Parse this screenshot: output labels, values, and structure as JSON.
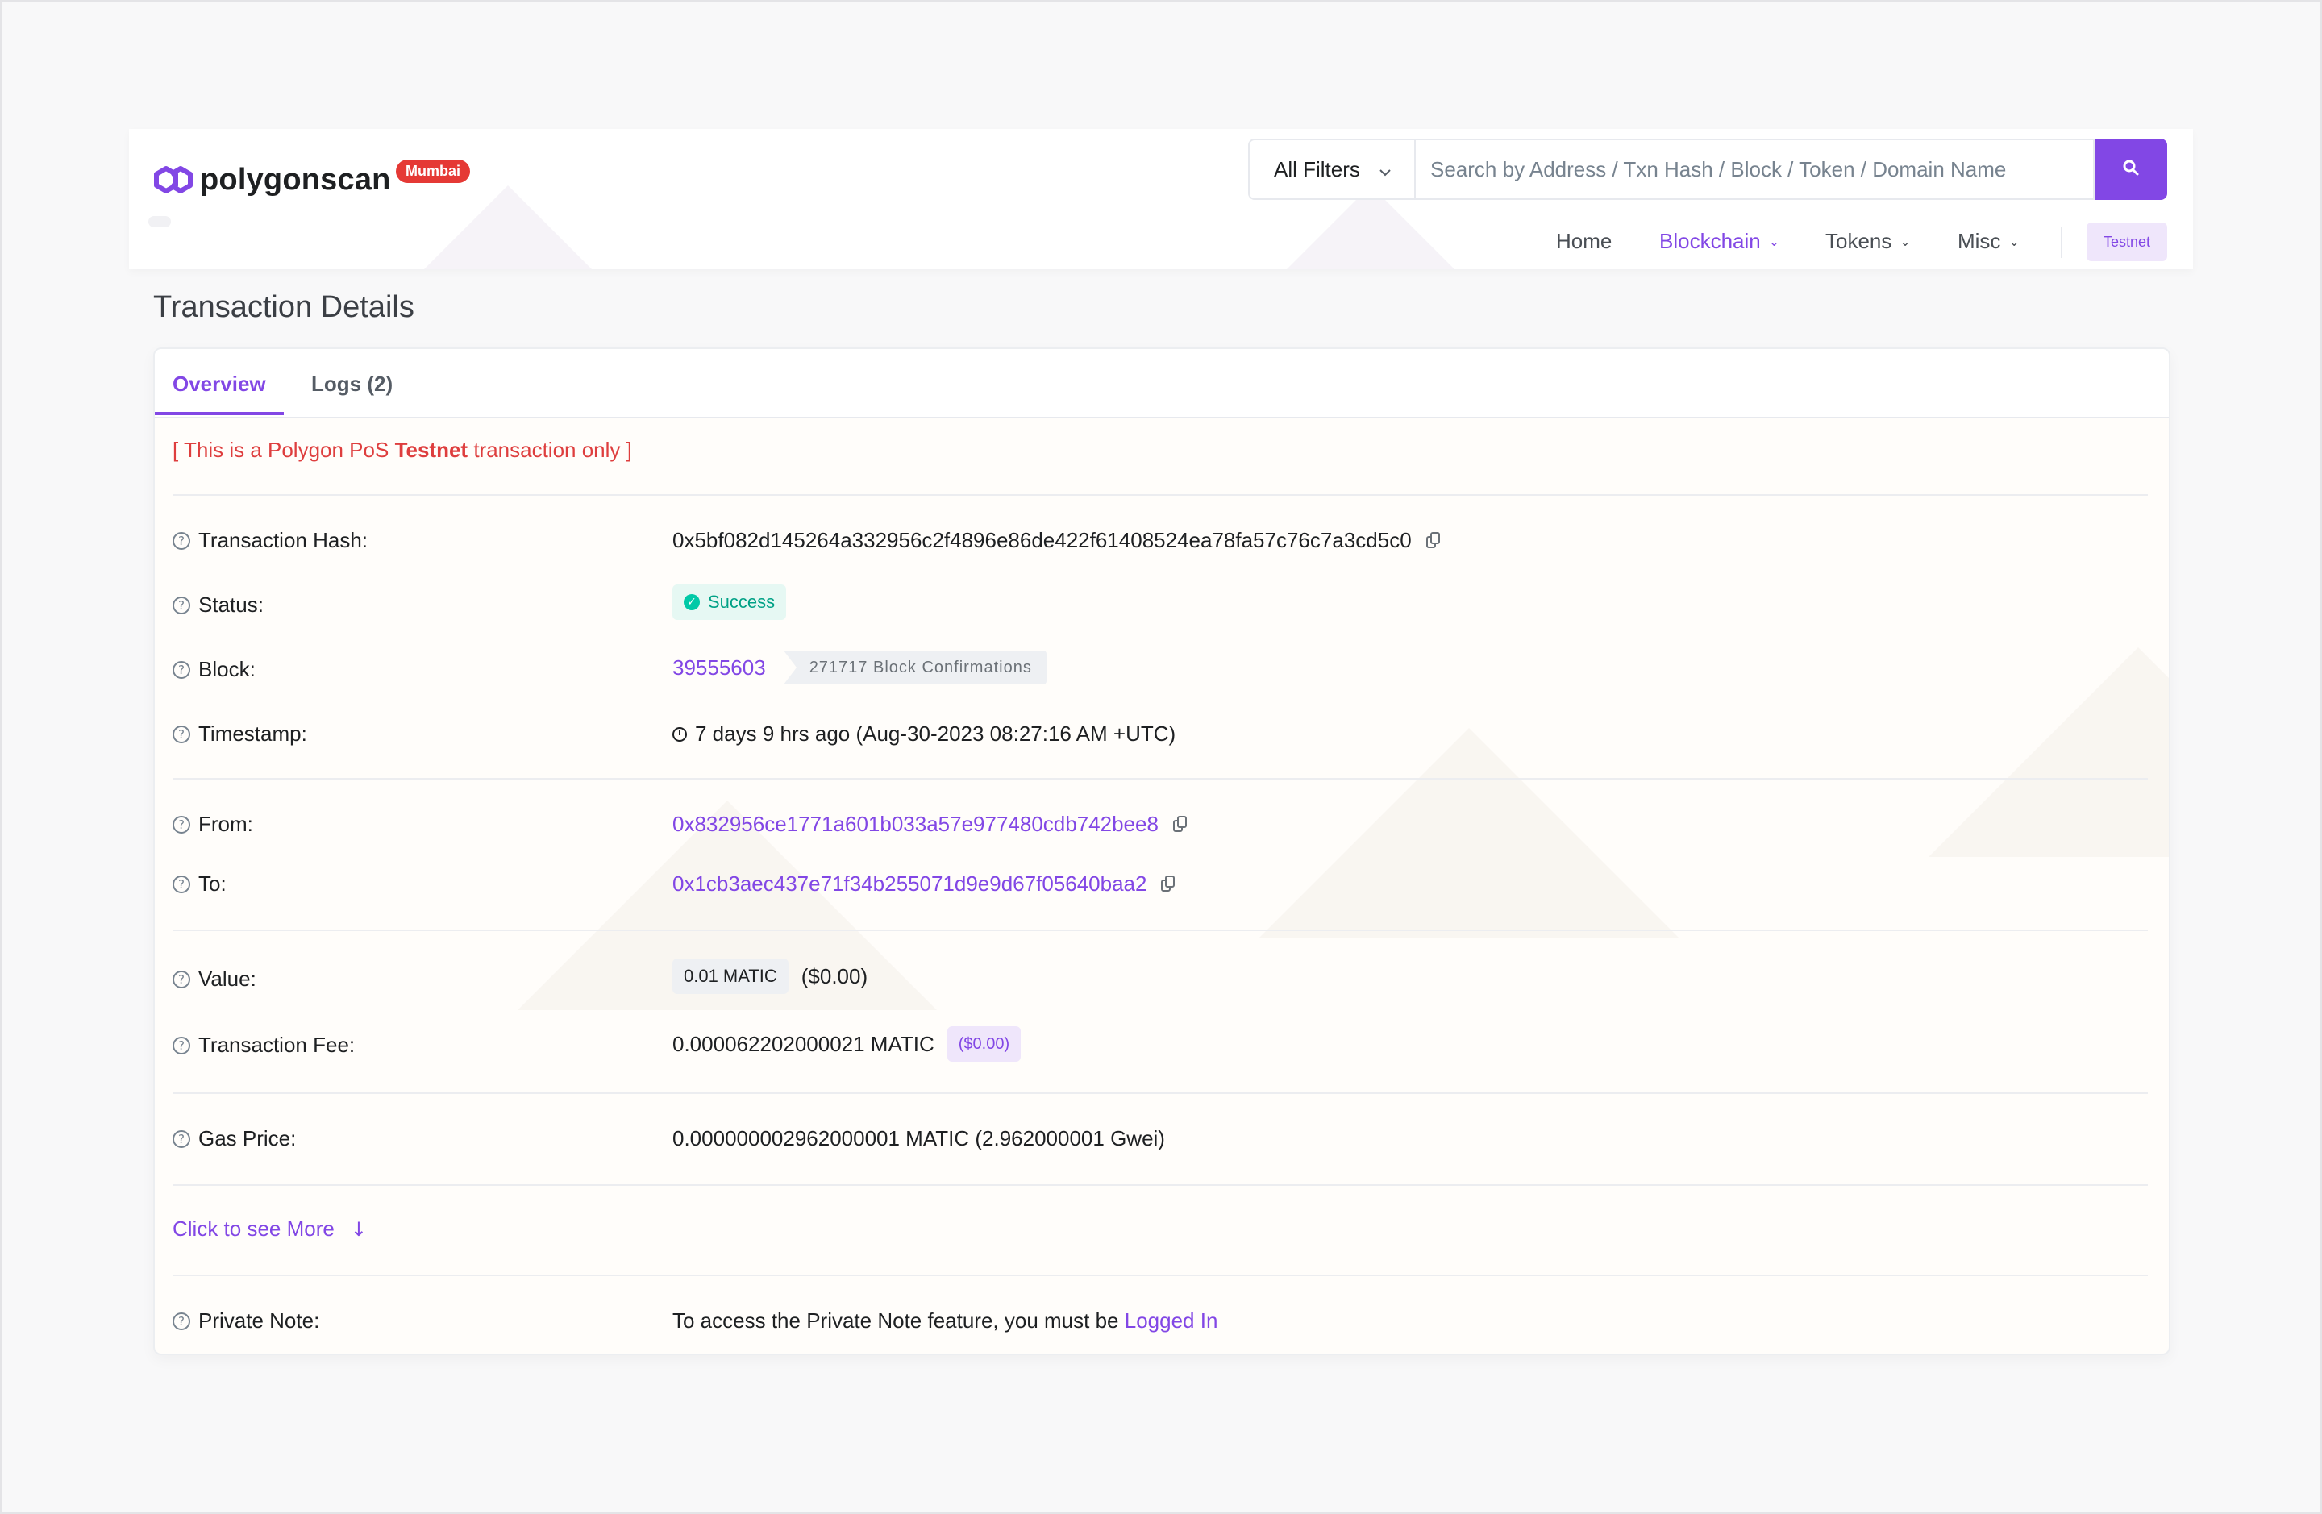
{
  "app": {
    "brand": "polygonscan",
    "network_badge": "Mumbai",
    "accent_color": "#8247e5"
  },
  "search": {
    "filter_label": "All Filters",
    "placeholder": "Search by Address / Txn Hash / Block / Token / Domain Name"
  },
  "nav": {
    "home": "Home",
    "blockchain": "Blockchain",
    "tokens": "Tokens",
    "misc": "Misc",
    "testnet": "Testnet"
  },
  "page": {
    "title": "Transaction Details"
  },
  "tabs": [
    {
      "label": "Overview",
      "active": true
    },
    {
      "label": "Logs (2)",
      "active": false
    }
  ],
  "notice": {
    "prefix": "[ This is a Polygon PoS ",
    "strong": "Testnet",
    "suffix": " transaction only ]"
  },
  "details": {
    "tx_hash": {
      "label": "Transaction Hash:",
      "value": "0x5bf082d145264a332956c2f4896e86de422f61408524ea78fa57c76c7a3cd5c0"
    },
    "status": {
      "label": "Status:",
      "value": "Success"
    },
    "block": {
      "label": "Block:",
      "value": "39555603",
      "confirmations": "271717 Block Confirmations"
    },
    "timestamp": {
      "label": "Timestamp:",
      "value": "7 days 9 hrs ago (Aug-30-2023 08:27:16 AM +UTC)"
    },
    "from": {
      "label": "From:",
      "value": "0x832956ce1771a601b033a57e977480cdb742bee8"
    },
    "to": {
      "label": "To:",
      "value": "0x1cb3aec437e71f34b255071d9e9d67f05640baa2"
    },
    "value": {
      "label": "Value:",
      "amount": "0.01 MATIC",
      "usd": "($0.00)"
    },
    "fee": {
      "label": "Transaction Fee:",
      "amount": "0.000062202000021 MATIC",
      "usd": "($0.00)"
    },
    "gas_price": {
      "label": "Gas Price:",
      "value": "0.000000002962000001 MATIC (2.962000001 Gwei)"
    }
  },
  "see_more": "Click to see More",
  "private_note": {
    "label": "Private Note:",
    "text": "To access the Private Note feature, you must be ",
    "link": "Logged In"
  }
}
